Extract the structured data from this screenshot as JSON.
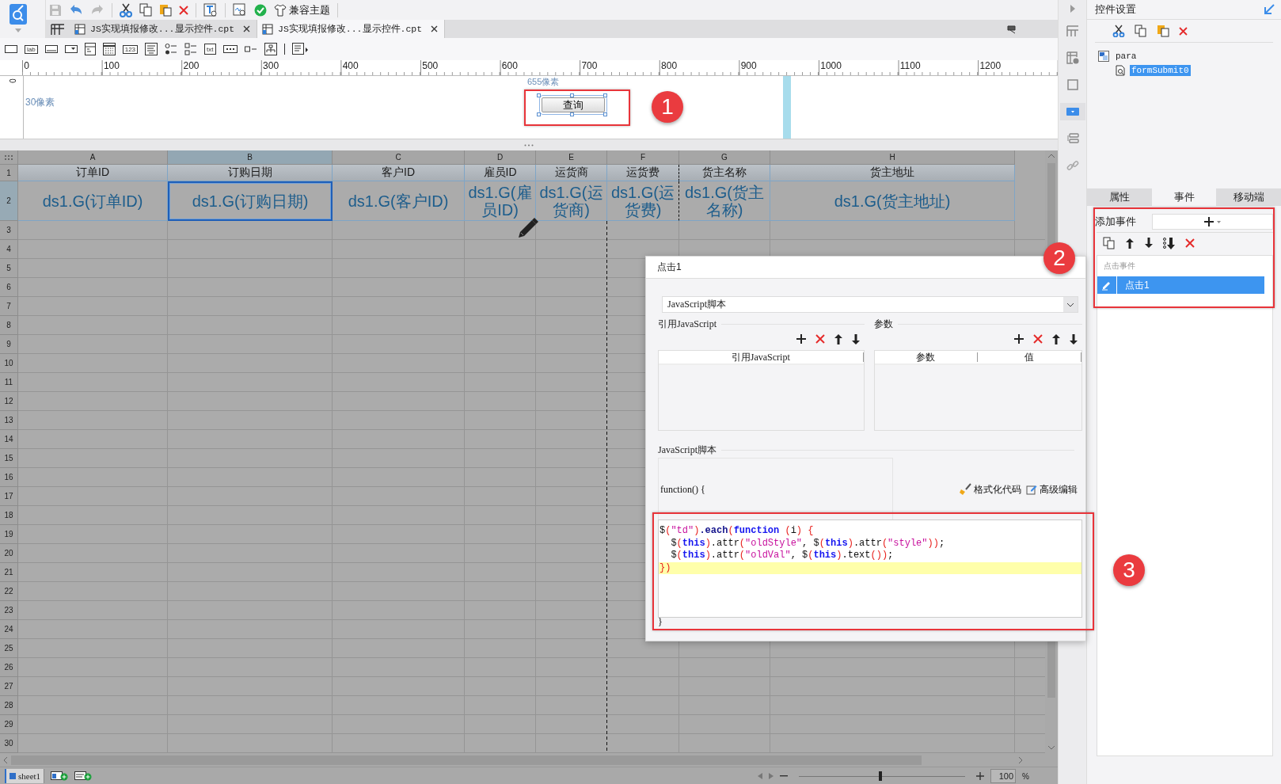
{
  "toolbar": {
    "theme_button": "兼容主题"
  },
  "tabs": [
    {
      "label": "JS实现填报修改...显示控件.cpt",
      "selected": false
    },
    {
      "label": "JS实现填报修改...显示控件.cpt",
      "selected": true
    }
  ],
  "palette_labels": [
    "lab",
    "123",
    "txt"
  ],
  "ruler": {
    "marks": [
      "0",
      "100",
      "200",
      "300",
      "400",
      "500",
      "600",
      "700",
      "800",
      "900",
      "1000",
      "1100",
      "1200"
    ],
    "vertical_mark": "0"
  },
  "form": {
    "height_label": "30像素",
    "width_label": "655像素",
    "button": {
      "label": "查询",
      "selected": true
    }
  },
  "sheet": {
    "columns": [
      {
        "letter": "A",
        "selected": false
      },
      {
        "letter": "B",
        "selected": true
      },
      {
        "letter": "C",
        "selected": false
      },
      {
        "letter": "D",
        "selected": false
      },
      {
        "letter": "E",
        "selected": false
      },
      {
        "letter": "F",
        "selected": false
      },
      {
        "letter": "G",
        "selected": false
      },
      {
        "letter": "H",
        "selected": false
      }
    ],
    "row_numbers": [
      "1",
      "2",
      "3",
      "4",
      "5",
      "6",
      "7",
      "8",
      "9",
      "10",
      "11",
      "12",
      "13",
      "14",
      "15",
      "16",
      "17",
      "18",
      "19",
      "20",
      "21",
      "22",
      "23",
      "24",
      "25",
      "26",
      "27",
      "28",
      "29",
      "30"
    ],
    "header_row": [
      "订单ID",
      "订购日期",
      "客户ID",
      "雇员ID",
      "运货商",
      "运货费",
      "货主名称",
      "货主地址"
    ],
    "field_row": [
      {
        "text": "ds1.G(订单ID)",
        "selected": false
      },
      {
        "text": "ds1.G(订购日期)",
        "selected": true
      },
      {
        "text": "ds1.G(客户ID)",
        "selected": false
      },
      {
        "text": "ds1.G(雇员ID)",
        "selected": false
      },
      {
        "text": "ds1.G(运货商)",
        "selected": false
      },
      {
        "text": "ds1.G(运货费)",
        "selected": false
      },
      {
        "text": "ds1.G(货主名称)",
        "selected": false
      },
      {
        "text": "ds1.G(货主地址)",
        "selected": false
      }
    ]
  },
  "sheet_tabs": [
    {
      "label": "sheet1",
      "selected": true
    }
  ],
  "zoom": {
    "level": 0.49,
    "value": "100",
    "unit": "%"
  },
  "side_tools": [
    {
      "selected": false
    },
    {
      "selected": false
    },
    {
      "selected": false
    },
    {
      "selected": true
    },
    {
      "selected": false
    },
    {
      "selected": false
    }
  ],
  "panel": {
    "title": "控件设置",
    "tree": [
      {
        "label": "para",
        "children": [
          {
            "label": "formSubmit0",
            "selected": true
          }
        ]
      }
    ],
    "tabs": [
      {
        "label": "属性",
        "selected": false
      },
      {
        "label": "事件",
        "selected": true
      },
      {
        "label": "移动端",
        "selected": false
      }
    ],
    "add_event_label": "添加事件",
    "event_group": "点击事件",
    "events": [
      {
        "label": "点击1",
        "selected": true
      }
    ]
  },
  "dialog": {
    "title": "点击1",
    "script_type": "JavaScript脚本",
    "ref_section": "引用JavaScript",
    "ref_columns": [
      "引用JavaScript"
    ],
    "param_section": "参数",
    "param_columns": [
      "参数",
      "值"
    ],
    "script_section": "JavaScript脚本",
    "function_header": "function() {",
    "format_button": "格式化代码",
    "advanced_button": "高级编辑",
    "code": [
      {
        "highlighted": false,
        "tokens": [
          {
            "text": "$",
            "kind": "plain"
          },
          {
            "text": "(",
            "kind": "punct"
          },
          {
            "text": "\"td\"",
            "kind": "string"
          },
          {
            "text": ")",
            "kind": "punct"
          },
          {
            "text": ".each",
            "kind": "method"
          },
          {
            "text": "(",
            "kind": "punct"
          },
          {
            "text": "function",
            "kind": "keyword"
          },
          {
            "text": " (",
            "kind": "punct"
          },
          {
            "text": "i",
            "kind": "plain"
          },
          {
            "text": ") {",
            "kind": "punct"
          }
        ]
      },
      {
        "highlighted": false,
        "tokens": [
          {
            "text": "  $",
            "kind": "plain"
          },
          {
            "text": "(",
            "kind": "punct"
          },
          {
            "text": "this",
            "kind": "keyword"
          },
          {
            "text": ")",
            "kind": "punct"
          },
          {
            "text": ".attr",
            "kind": "plain"
          },
          {
            "text": "(",
            "kind": "punct"
          },
          {
            "text": "\"oldStyle\"",
            "kind": "string"
          },
          {
            "text": ", $",
            "kind": "plain"
          },
          {
            "text": "(",
            "kind": "punct"
          },
          {
            "text": "this",
            "kind": "keyword"
          },
          {
            "text": ")",
            "kind": "punct"
          },
          {
            "text": ".attr",
            "kind": "plain"
          },
          {
            "text": "(",
            "kind": "punct"
          },
          {
            "text": "\"style\"",
            "kind": "string"
          },
          {
            "text": "))",
            "kind": "punct"
          },
          {
            "text": ";",
            "kind": "plain"
          }
        ]
      },
      {
        "highlighted": false,
        "tokens": [
          {
            "text": "  $",
            "kind": "plain"
          },
          {
            "text": "(",
            "kind": "punct"
          },
          {
            "text": "this",
            "kind": "keyword"
          },
          {
            "text": ")",
            "kind": "punct"
          },
          {
            "text": ".attr",
            "kind": "plain"
          },
          {
            "text": "(",
            "kind": "punct"
          },
          {
            "text": "\"oldVal\"",
            "kind": "string"
          },
          {
            "text": ", $",
            "kind": "plain"
          },
          {
            "text": "(",
            "kind": "punct"
          },
          {
            "text": "this",
            "kind": "keyword"
          },
          {
            "text": ")",
            "kind": "punct"
          },
          {
            "text": ".text",
            "kind": "plain"
          },
          {
            "text": "())",
            "kind": "punct"
          },
          {
            "text": ";",
            "kind": "plain"
          }
        ]
      },
      {
        "highlighted": true,
        "tokens": [
          {
            "text": "})",
            "kind": "punct"
          }
        ]
      }
    ],
    "closing_brace": "}"
  },
  "annotations": [
    "1",
    "2",
    "3"
  ]
}
